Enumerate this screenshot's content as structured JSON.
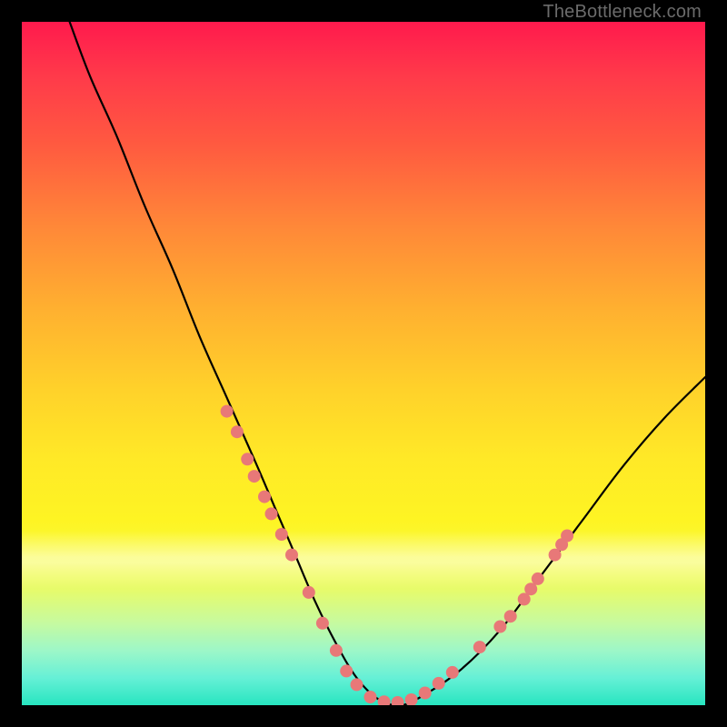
{
  "watermark": "TheBottleneck.com",
  "chart_data": {
    "type": "line",
    "title": "",
    "xlabel": "",
    "ylabel": "",
    "xlim": [
      0,
      100
    ],
    "ylim": [
      0,
      100
    ],
    "grid": false,
    "legend": false,
    "series": [
      {
        "name": "curve",
        "x": [
          7,
          10,
          14,
          18,
          22,
          26,
          30,
          34,
          37,
          40,
          43,
          46,
          49,
          52,
          55,
          58,
          64,
          70,
          76,
          82,
          88,
          94,
          100
        ],
        "y": [
          100,
          92,
          83,
          73,
          64,
          54,
          45,
          36,
          29,
          22,
          15,
          9,
          4,
          1,
          0,
          1,
          5,
          11,
          19,
          27,
          35,
          42,
          48
        ]
      }
    ],
    "markers": [
      {
        "x": 30.0,
        "y": 43.0
      },
      {
        "x": 31.5,
        "y": 40.0
      },
      {
        "x": 33.0,
        "y": 36.0
      },
      {
        "x": 34.0,
        "y": 33.5
      },
      {
        "x": 35.5,
        "y": 30.5
      },
      {
        "x": 36.5,
        "y": 28.0
      },
      {
        "x": 38.0,
        "y": 25.0
      },
      {
        "x": 39.5,
        "y": 22.0
      },
      {
        "x": 42.0,
        "y": 16.5
      },
      {
        "x": 44.0,
        "y": 12.0
      },
      {
        "x": 46.0,
        "y": 8.0
      },
      {
        "x": 47.5,
        "y": 5.0
      },
      {
        "x": 49.0,
        "y": 3.0
      },
      {
        "x": 51.0,
        "y": 1.2
      },
      {
        "x": 53.0,
        "y": 0.5
      },
      {
        "x": 55.0,
        "y": 0.4
      },
      {
        "x": 57.0,
        "y": 0.8
      },
      {
        "x": 59.0,
        "y": 1.8
      },
      {
        "x": 61.0,
        "y": 3.2
      },
      {
        "x": 63.0,
        "y": 4.8
      },
      {
        "x": 67.0,
        "y": 8.5
      },
      {
        "x": 70.0,
        "y": 11.5
      },
      {
        "x": 71.5,
        "y": 13.0
      },
      {
        "x": 73.5,
        "y": 15.5
      },
      {
        "x": 74.5,
        "y": 17.0
      },
      {
        "x": 75.5,
        "y": 18.5
      },
      {
        "x": 78.0,
        "y": 22.0
      },
      {
        "x": 79.0,
        "y": 23.5
      },
      {
        "x": 79.8,
        "y": 24.8
      }
    ],
    "marker_style": {
      "color": "#e87878",
      "radius_px": 7
    },
    "gradient_stops": [
      {
        "pos": 0.0,
        "color": "#ff1a4d"
      },
      {
        "pos": 0.3,
        "color": "#ff8838"
      },
      {
        "pos": 0.6,
        "color": "#ffe927"
      },
      {
        "pos": 0.85,
        "color": "#c6faa0"
      },
      {
        "pos": 1.0,
        "color": "#27e5c0"
      }
    ]
  }
}
